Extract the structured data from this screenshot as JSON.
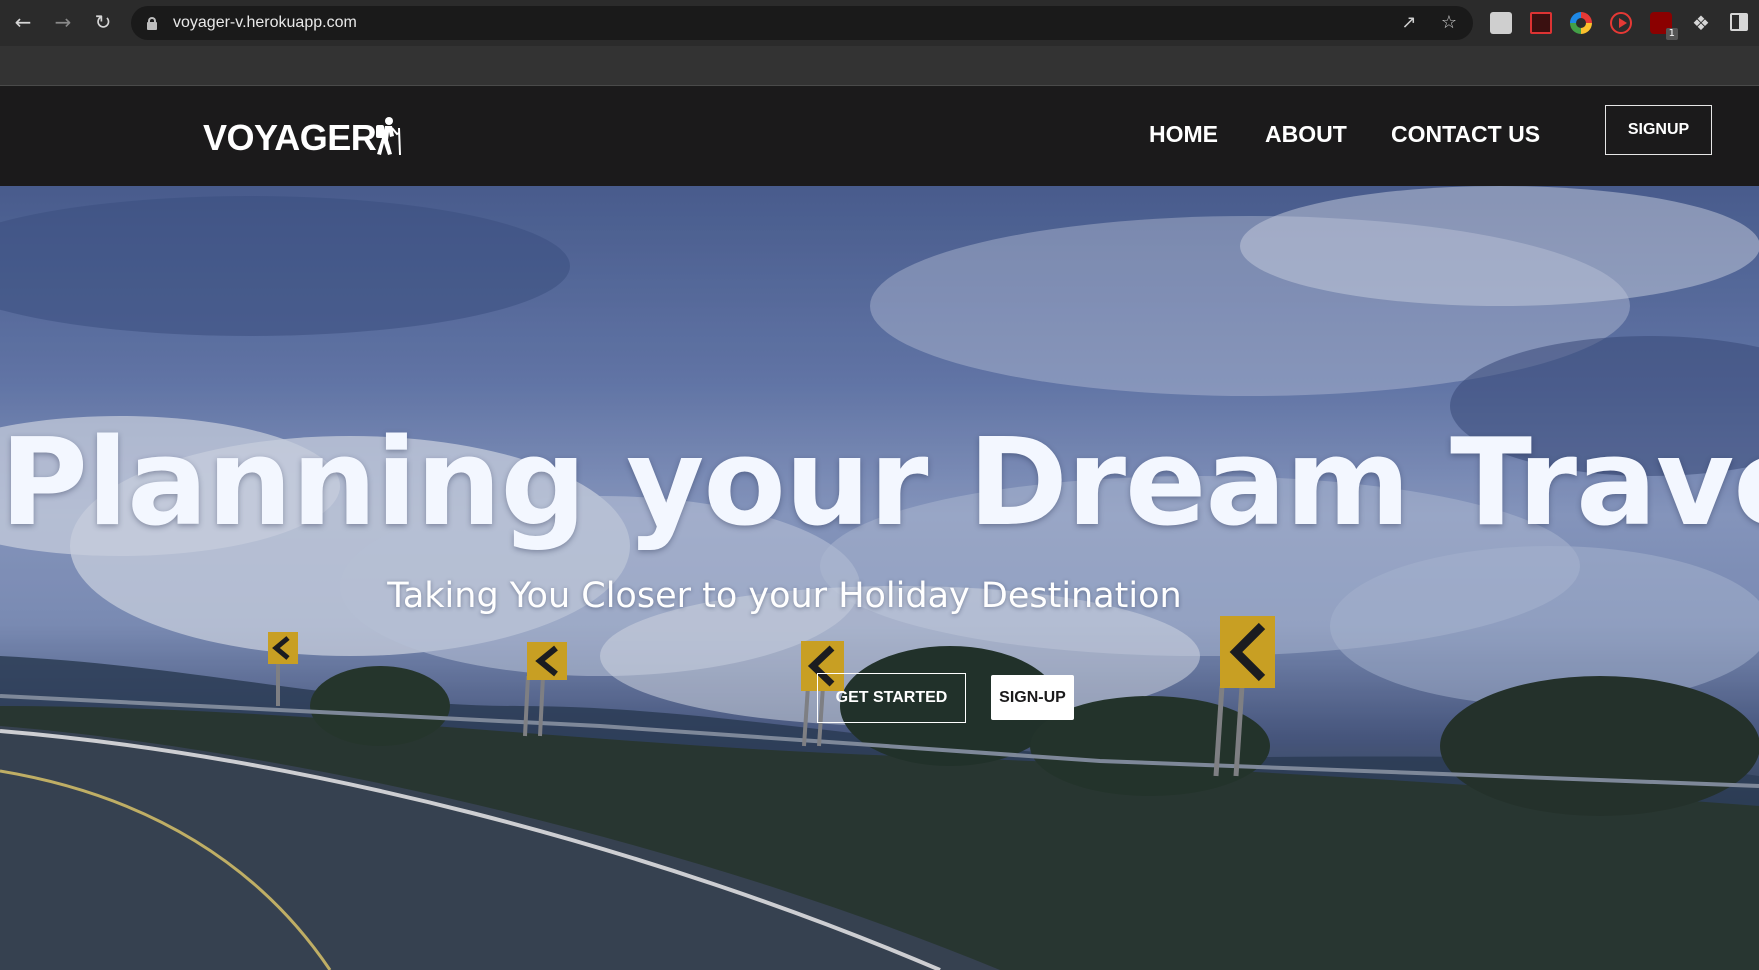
{
  "browser": {
    "url": "voyager-v.herokuapp.com",
    "icons": [
      "back-icon",
      "forward-icon",
      "reload-icon",
      "lock-icon",
      "share-icon",
      "bookmark-star-icon",
      "extension-icons",
      "puzzle-icon",
      "side-panel-icon"
    ],
    "extension_badge": "1"
  },
  "header": {
    "brand": "VOYAGER",
    "brand_icon": "hiker-icon",
    "nav": {
      "home": "HOME",
      "about": "ABOUT",
      "contact": "CONTACT US"
    },
    "signup": "SIGNUP"
  },
  "hero": {
    "title": "Planning your Dream Travel",
    "subtitle": "Taking You Closer to your Holiday Destination",
    "get_started": "GET STARTED",
    "signup": "SIGN-UP"
  },
  "colors": {
    "header_bg": "#1b1a1b",
    "chrome_bg": "#2b2b2b",
    "hero_sky": "#6b80b3",
    "title_text": "#f3f7ff"
  }
}
